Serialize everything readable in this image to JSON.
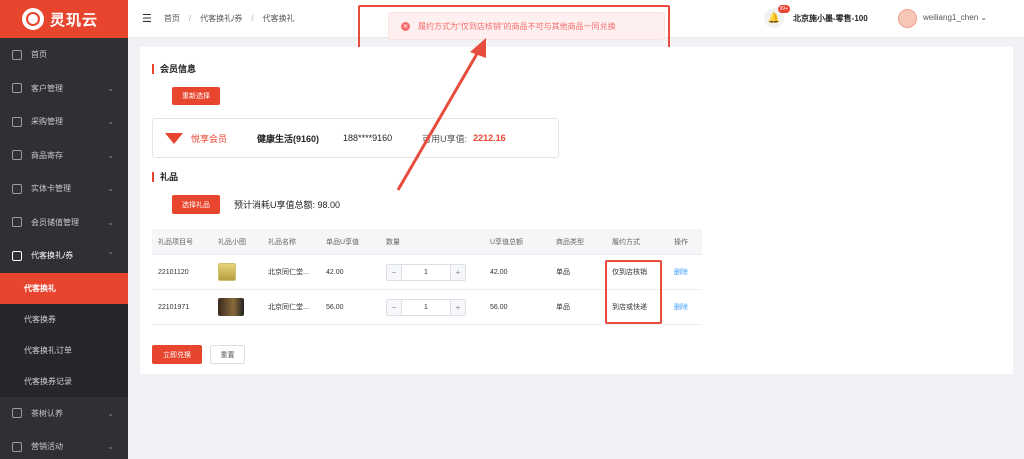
{
  "sidebar": {
    "brand": "灵玑云",
    "items": [
      {
        "label": "首页",
        "icon": "grid-icon",
        "expandable": false
      },
      {
        "label": "客户管理",
        "icon": "user-card-icon",
        "expandable": true
      },
      {
        "label": "采购管理",
        "icon": "purchase-icon",
        "expandable": true
      },
      {
        "label": "商品寄存",
        "icon": "box-icon",
        "expandable": true
      },
      {
        "label": "实体卡管理",
        "icon": "book-icon",
        "expandable": true
      },
      {
        "label": "会员储值管理",
        "icon": "wallet-icon",
        "expandable": true
      }
    ],
    "open_group": {
      "label": "代客换礼/券",
      "icon": "cart-icon"
    },
    "sub_items": [
      {
        "label": "代客换礼",
        "active": true
      },
      {
        "label": "代客换券",
        "active": false
      },
      {
        "label": "代客换礼订单",
        "active": false
      },
      {
        "label": "代客换券记录",
        "active": false
      }
    ],
    "bottom_items": [
      {
        "label": "茶树认养",
        "icon": "heart-icon"
      },
      {
        "label": "营销活动",
        "icon": "megaphone-icon"
      }
    ]
  },
  "header": {
    "breadcrumb": [
      "首页",
      "代客换礼/券",
      "代客换礼"
    ],
    "notification_badge": "99+",
    "store": "北京施小墨-零售-100",
    "user": "weiliang1_chen"
  },
  "toast": {
    "message": "履约方式为\"仅到店核销\"的商品不可与其他商品一同兑换",
    "type": "error"
  },
  "member": {
    "section_title": "会员信息",
    "reselect_label": "重新选择",
    "level": "悦享会员",
    "name": "健康生活(9160)",
    "phone": "188****9160",
    "u_label": "可用U享值:",
    "u_value": "2212.16"
  },
  "gifts": {
    "section_title": "礼品",
    "select_label": "选择礼品",
    "total_label": "预计消耗U享值总额: 98.00",
    "columns": [
      "礼品项目号",
      "礼品小图",
      "礼品名称",
      "单品U享值",
      "数量",
      "U享值总额",
      "商品类型",
      "履约方式",
      "操作"
    ],
    "rows": [
      {
        "id": "22101120",
        "name": "北京同仁堂...",
        "unit": "42.00",
        "qty": "1",
        "total": "42.00",
        "type": "单品",
        "fulfill": "仅到店核销",
        "action": "删除"
      },
      {
        "id": "22101971",
        "name": "北京同仁堂...",
        "unit": "56.00",
        "qty": "1",
        "total": "56.00",
        "type": "单品",
        "fulfill": "到店或快递",
        "action": "删除"
      }
    ]
  },
  "actions": {
    "redeem": "立即兑换",
    "reset": "重置"
  },
  "colors": {
    "brand": "#e8452e",
    "sidebar_bg": "#2f3033",
    "error": "#f56c6c",
    "link": "#409eff",
    "annotation": "#e74c3c"
  }
}
